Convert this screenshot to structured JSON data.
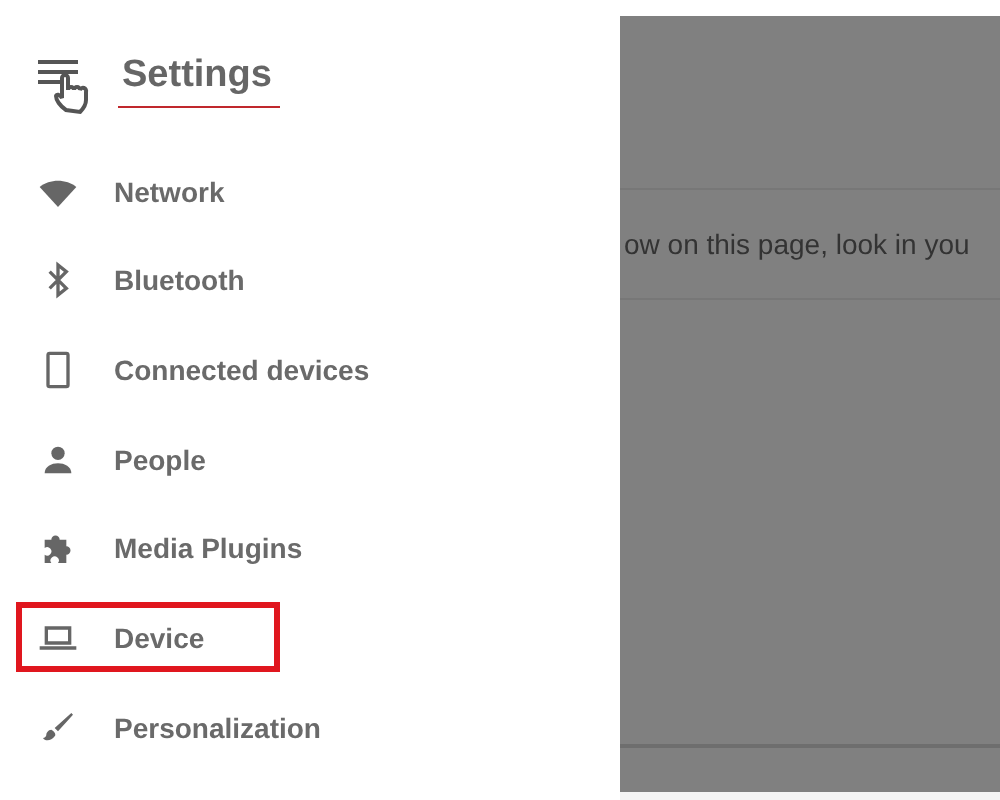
{
  "header": {
    "title": "Settings"
  },
  "sidebar": {
    "items": [
      {
        "label": "Network",
        "highlighted": false
      },
      {
        "label": "Bluetooth",
        "highlighted": false
      },
      {
        "label": "Connected devices",
        "highlighted": false
      },
      {
        "label": "People",
        "highlighted": false
      },
      {
        "label": "Media Plugins",
        "highlighted": false
      },
      {
        "label": "Device",
        "highlighted": true
      },
      {
        "label": "Personalization",
        "highlighted": false
      }
    ]
  },
  "background_page": {
    "text": "ow on this page, look in you"
  }
}
